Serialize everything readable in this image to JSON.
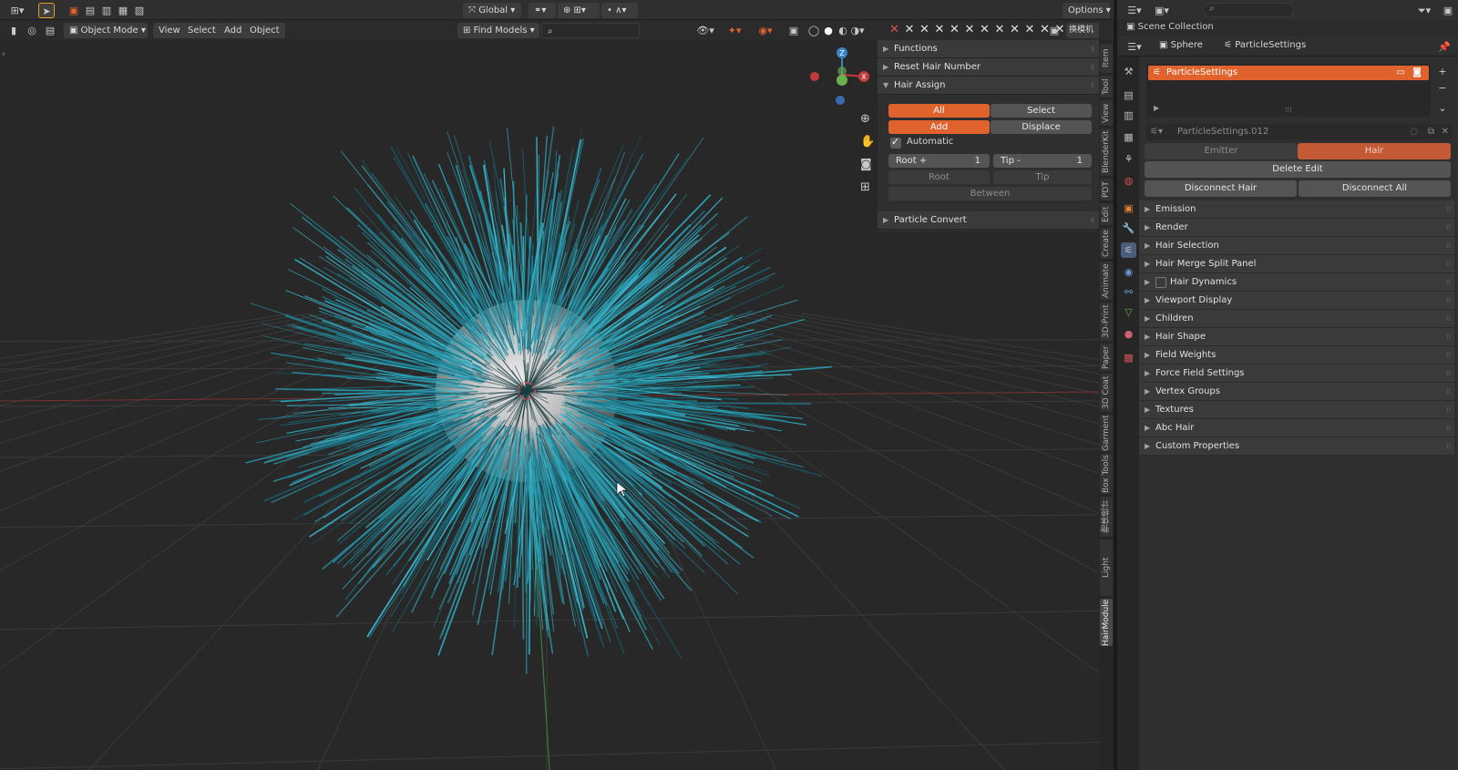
{
  "top_header": {
    "transform_orientation": "Global",
    "options_label": "Options",
    "x_marks": [
      "✕",
      "✕",
      "✕",
      "✕",
      "✕",
      "✕",
      "✕",
      "✕",
      "✕",
      "✕",
      "✕",
      "✕"
    ]
  },
  "viewport_header": {
    "mode": "Object Mode",
    "menus": [
      "View",
      "Select",
      "Add",
      "Object"
    ],
    "find_models": "Find Models",
    "right_label": "换模机"
  },
  "npanel": {
    "panels": {
      "functions": "Functions",
      "reset_hair_number": "Reset Hair Number",
      "hair_assign": "Hair Assign",
      "particle_convert": "Particle Convert"
    },
    "buttons": {
      "all": "All",
      "select": "Select",
      "add": "Add",
      "displace": "Displace",
      "root": "Root",
      "tip": "Tip",
      "between": "Between"
    },
    "automatic_label": "Automatic",
    "automatic_checked": true,
    "root_field": {
      "label": "Root +",
      "value": "1"
    },
    "tip_field": {
      "label": "Tip -",
      "value": "1"
    }
  },
  "side_tabs": [
    "Item",
    "Tool",
    "View",
    "BlenderKit",
    "PDT",
    "Edit",
    "Create",
    "Animate",
    "3D-Print",
    "Paper",
    "3D Coat",
    "Garment",
    "Box Tools",
    "物体统计",
    "Light Manager",
    "HairModule"
  ],
  "side_tab_active": "HairModule",
  "outliner": {
    "scene_collection": "Scene Collection"
  },
  "properties": {
    "breadcrumb": [
      "Sphere",
      "ParticleSettings"
    ],
    "particle_system": "ParticleSettings",
    "settings_name": "ParticleSettings.012",
    "type_options": [
      "Emitter",
      "Hair"
    ],
    "type_selected": "Hair",
    "delete_edit": "Delete Edit",
    "disconnect_hair": "Disconnect Hair",
    "disconnect_all": "Disconnect All",
    "sections": [
      "Emission",
      "Render",
      "Hair Selection",
      "Hair Merge Split Panel",
      "Hair Dynamics",
      "Viewport Display",
      "Children",
      "Hair Shape",
      "Field Weights",
      "Force Field Settings",
      "Vertex Groups",
      "Textures",
      "Abc Hair",
      "Custom Properties"
    ]
  },
  "colors": {
    "accent": "#e0622c",
    "hair": "#2aa3b8",
    "background": "#282828"
  },
  "gizmo_axes": [
    "X",
    "Y",
    "Z"
  ]
}
